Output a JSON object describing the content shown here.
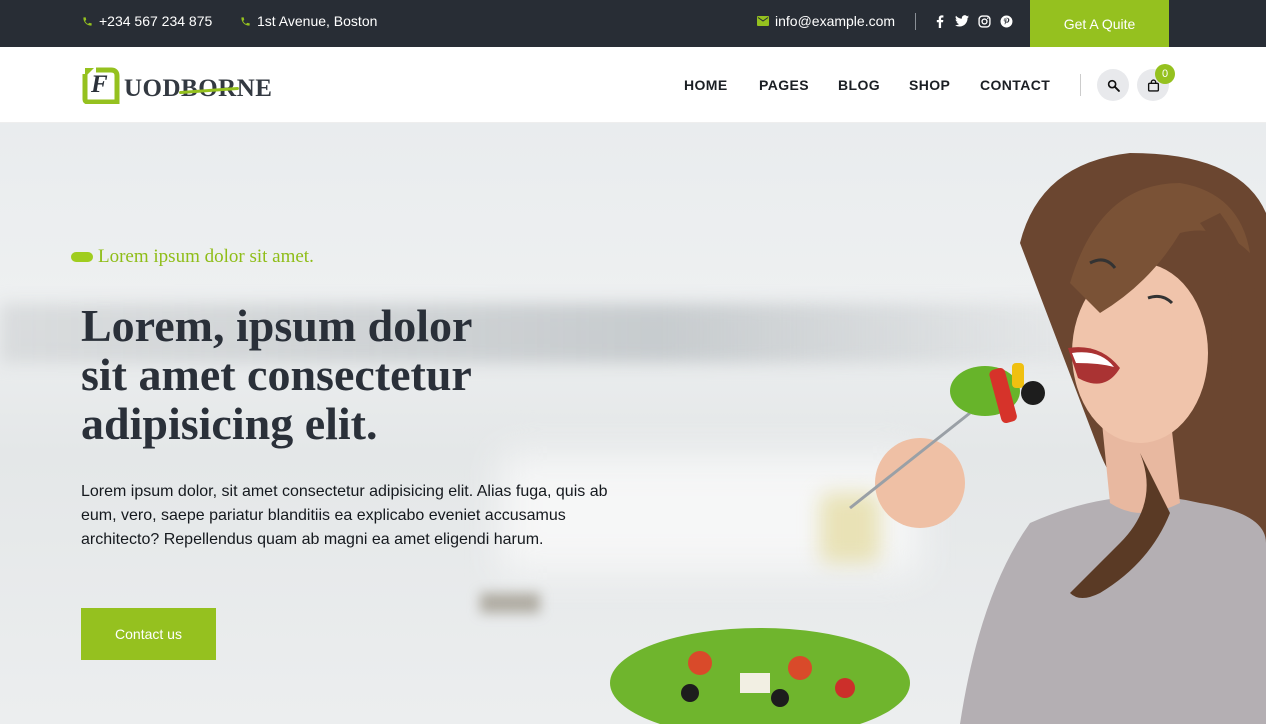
{
  "topbar": {
    "phone": "+234 567 234 875",
    "address": "1st Avenue, Boston",
    "email": "info@example.com",
    "social": [
      "facebook-icon",
      "twitter-icon",
      "instagram-icon",
      "pinterest-icon"
    ],
    "cta_label": "Get A Quite"
  },
  "header": {
    "logo_letter": "F",
    "logo_text": "UODBORNE",
    "nav": [
      "HOME",
      "PAGES",
      "BLOG",
      "SHOP",
      "CONTACT"
    ],
    "cart_count": "0"
  },
  "hero": {
    "tagline": "Lorem ipsum dolor sit amet.",
    "title": "Lorem, ipsum dolor\nsit amet consectetur\nadipisicing elit.",
    "description": "Lorem ipsum dolor, sit amet consectetur adipisicing elit. Alias fuga, quis ab eum, vero, saepe pariatur blanditiis ea explicabo eveniet accusamus architecto? Repellendus quam ab magni ea amet eligendi harum.",
    "button_label": "Contact us"
  },
  "colors": {
    "accent": "#95c11f",
    "topbar_bg": "#282d35",
    "heading": "#2a3039"
  }
}
